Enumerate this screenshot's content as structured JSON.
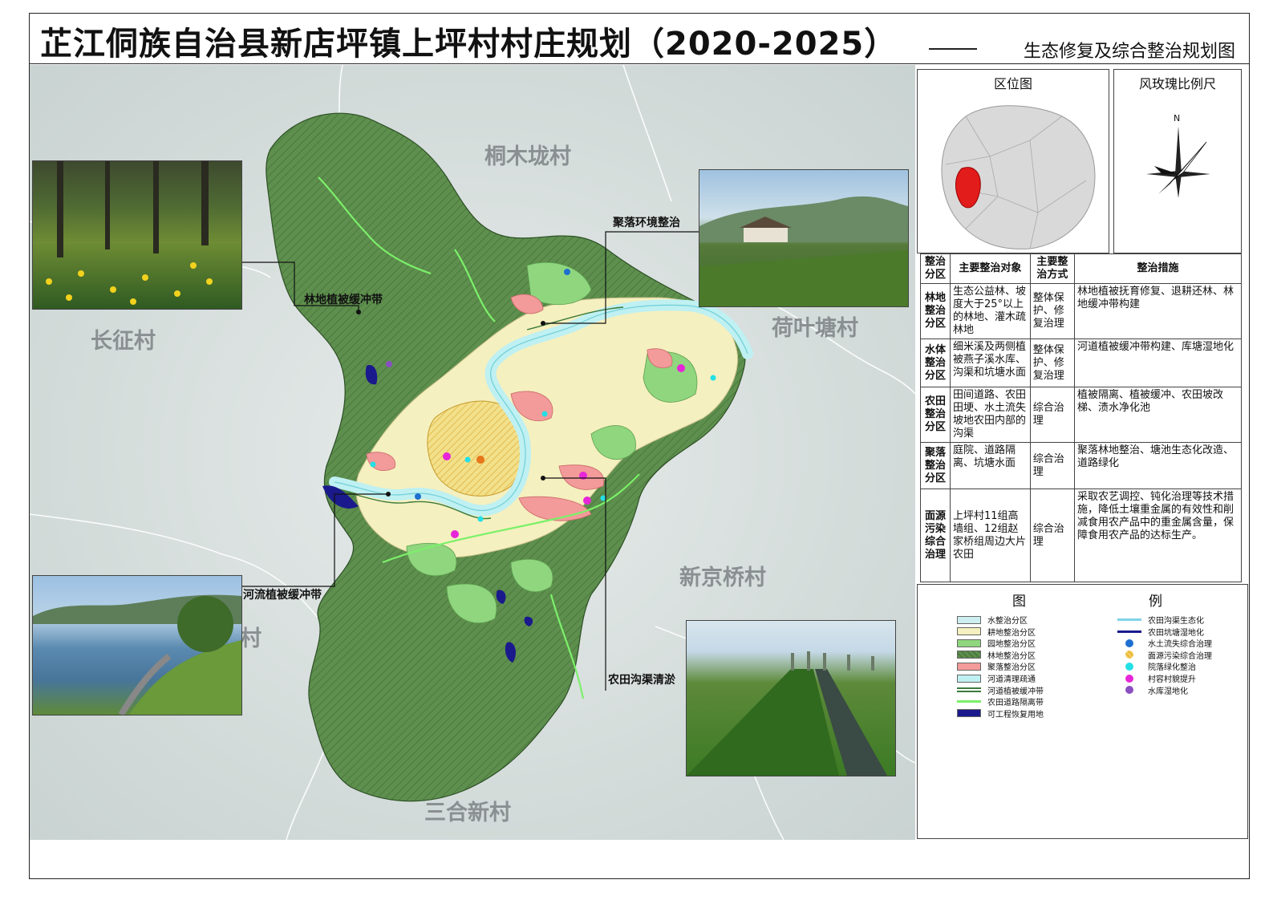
{
  "header": {
    "title": "芷江侗族自治县新店坪镇上坪村村庄规划（2020-2025）",
    "subtitle": "生态修复及综合整治规划图"
  },
  "map": {
    "villages": {
      "tongmulong": "桐木垅村",
      "changzheng": "长征村",
      "heyetang": "荷叶塘村",
      "xinjingqiao": "新京桥村",
      "sanhexin": "三合新村",
      "partial": "村"
    },
    "callouts": {
      "forest_buffer": "林地植被缓冲带",
      "settlement": "聚落环境整治",
      "river_buffer": "河流植被缓冲带",
      "ditch": "农田沟渠清淤"
    }
  },
  "location_map": {
    "title": "区位图"
  },
  "compass": {
    "title": "风玫瑰比例尺",
    "north": "N"
  },
  "regulation_table": {
    "headers": [
      "整治分区",
      "主要整治对象",
      "主要整治方式",
      "整治措施"
    ],
    "rows": [
      {
        "zone": "林地整治分区",
        "objects": "生态公益林、坡度大于25°以上的林地、灌木疏林地",
        "method": "整体保护、修复治理",
        "measures": "林地植被抚育修复、退耕还林、林地缓冲带构建"
      },
      {
        "zone": "水体整治分区",
        "objects": "细米溪及两侧植被燕子溪水库、沟渠和坑塘水面",
        "method": "整体保护、修复治理",
        "measures": "河道植被缓冲带构建、库塘湿地化"
      },
      {
        "zone": "农田整治分区",
        "objects": "田间道路、农田田埂、水土流失坡地农田内部的沟渠",
        "method": "综合治理",
        "measures": "植被隔离、植被缓冲、农田坡改梯、渍水净化池"
      },
      {
        "zone": "聚落整治分区",
        "objects": "庭院、道路隔离、坑塘水面",
        "method": "综合治理",
        "measures": "聚落林地整治、塘池生态化改造、道路绿化"
      },
      {
        "zone": "面源污染综合治理",
        "objects": "上坪村11组高墙组、12组赵家桥组周边大片农田",
        "method": "综合治理",
        "measures": "采取农艺调控、钝化治理等技术措施，降低土壤重金属的有效性和削减食用农产品中的重金属含量，保障食用农产品的达标生产。"
      }
    ]
  },
  "legend": {
    "title_left": "图",
    "title_right": "例",
    "left_items": [
      {
        "label": "水整治分区",
        "color": "#cdeef0"
      },
      {
        "label": "耕地整治分区",
        "color": "#f5f0bf"
      },
      {
        "label": "园地整治分区",
        "color": "#8fd67e"
      },
      {
        "label": "林地整治分区",
        "color": "#5e8f4e"
      },
      {
        "label": "聚落整治分区",
        "color": "#f39a9a"
      },
      {
        "label": "河道清理疏通",
        "color": "#bff0f2"
      },
      {
        "label": "河道植被缓冲带",
        "color": "#3c7a3c"
      },
      {
        "label": "农田道路隔离带",
        "color": "#7cf06a"
      },
      {
        "label": "可工程恢复用地",
        "color": "#1a1a8c"
      }
    ],
    "right_items": [
      {
        "label": "农田沟渠生态化",
        "color": "#7fd3e8"
      },
      {
        "label": "农田坑塘湿地化",
        "color": "#1a1a8c"
      },
      {
        "label": "水土流失综合治理",
        "color": "#1e6fd0"
      },
      {
        "label": "面源污染综合治理",
        "color": "#e8b53a"
      },
      {
        "label": "院落绿化整治",
        "color": "#22e0e6"
      },
      {
        "label": "村容村貌提升",
        "color": "#e626d8"
      },
      {
        "label": "水库湿地化",
        "color": "#8a4fc0"
      }
    ]
  }
}
